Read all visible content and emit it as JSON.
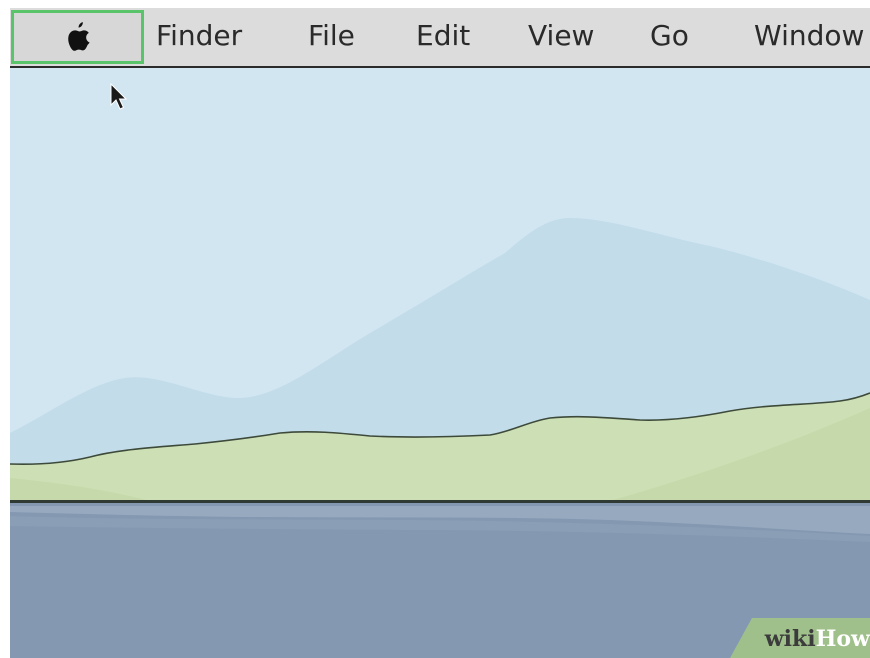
{
  "menubar": {
    "apple_icon": "apple-logo-icon",
    "items": [
      {
        "label": "Finder"
      },
      {
        "label": "File"
      },
      {
        "label": "Edit"
      },
      {
        "label": "View"
      },
      {
        "label": "Go"
      },
      {
        "label": "Window"
      }
    ],
    "highlight_color": "#5ac46b"
  },
  "watermark": {
    "part1": "wiki",
    "part2": "How"
  },
  "colors": {
    "sky": "#d2e6f1",
    "mountains": "#c2dcea",
    "hills": "#cddfb5",
    "water": "#8499b1",
    "menubar": "#dcdcdc"
  }
}
